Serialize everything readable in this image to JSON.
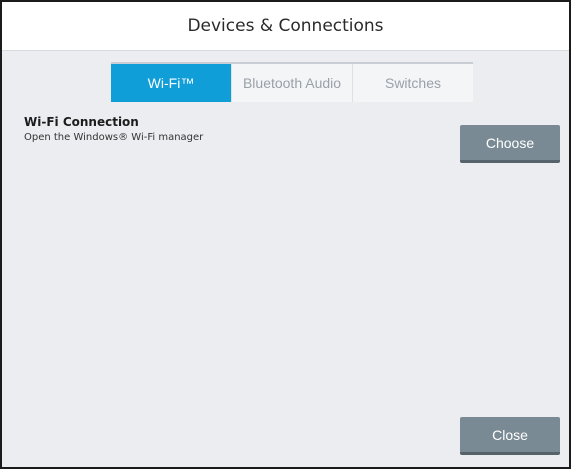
{
  "dialog": {
    "title": "Devices & Connections"
  },
  "tabs": [
    {
      "label": "Wi-Fi™",
      "active": true
    },
    {
      "label": "Bluetooth Audio",
      "active": false
    },
    {
      "label": "Switches",
      "active": false
    }
  ],
  "wifi_setting": {
    "heading": "Wi-Fi Connection",
    "description": "Open the Windows® Wi-Fi manager",
    "button_label": "Choose"
  },
  "footer": {
    "close_label": "Close"
  },
  "colors": {
    "accent": "#109ed9",
    "button": "#7a8a94",
    "panel_background": "#ebedf0"
  }
}
